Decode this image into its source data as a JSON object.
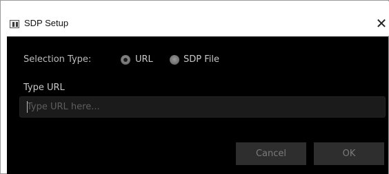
{
  "window": {
    "title": "SDP Setup",
    "close_glyph": "✕",
    "icon": "app-icon"
  },
  "form": {
    "selection_label": "Selection Type:",
    "options": [
      {
        "label": "URL",
        "checked": true
      },
      {
        "label": "SDP File",
        "checked": false
      }
    ],
    "url_label": "Type URL",
    "url_input": {
      "value": "",
      "placeholder": "Type URL here..."
    }
  },
  "buttons": {
    "cancel_label": "Cancel",
    "ok_label": "OK"
  },
  "colors": {
    "content_bg": "#000000",
    "input_bg": "#1b1b1b",
    "button_bg": "#2e2e2e",
    "text": "#c8c8c8"
  }
}
